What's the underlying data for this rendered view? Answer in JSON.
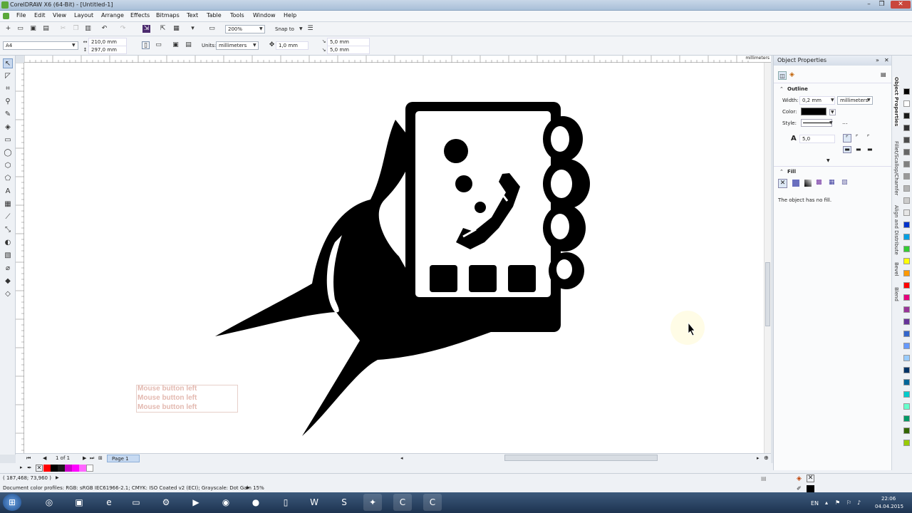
{
  "window": {
    "title": "CorelDRAW X6 (64-Bit) - [Untitled-1]",
    "minimize": "–",
    "restore": "❐",
    "close": "✕"
  },
  "menu": [
    "File",
    "Edit",
    "View",
    "Layout",
    "Arrange",
    "Effects",
    "Bitmaps",
    "Text",
    "Table",
    "Tools",
    "Window",
    "Help"
  ],
  "toolbar": {
    "zoom": "200%",
    "snap_to": "Snap to"
  },
  "property_bar": {
    "page_size": "A4",
    "width": "210,0 mm",
    "height": "297,0 mm",
    "units_label": "Units:",
    "units_value": "millimeters",
    "nudge": "1,0 mm",
    "dup_x": "5,0 mm",
    "dup_y": "5,0 mm"
  },
  "ruler": {
    "unit": "millimeters"
  },
  "object_properties": {
    "title": "Object Properties",
    "outline_title": "Outline",
    "width_label": "Width:",
    "width_value": "0,2 mm",
    "width_units": "millimeters",
    "color_label": "Color:",
    "style_label": "Style:",
    "style_more": "...",
    "miter_value": "5,0",
    "fill_title": "Fill",
    "fill_message": "The object has no fill."
  },
  "docker_tabs": [
    "Object Properties",
    "Fillet/Scallop/Chamfer",
    "Align and Distribute",
    "Bevel",
    "Blend"
  ],
  "page_nav": {
    "position": "1 of 1",
    "page_tab": "Page 1"
  },
  "mouse_labels": [
    "Mouse button left",
    "Mouse button left",
    "Mouse button left"
  ],
  "status": {
    "coords": "( 187,468; 73,960 )",
    "color_profiles": "Document color profiles: RGB: sRGB IEC61966-2.1; CMYK: ISO Coated v2 (ECI); Grayscale: Dot Gain 15%",
    "play_icon": "▶"
  },
  "taskbar": {
    "language": "EN",
    "time": "22:06",
    "date": "04.04.2015"
  },
  "colors": {
    "accent": "#3a6ea5",
    "palette": [
      "#000000",
      "#ffffff",
      "#1a1a1a",
      "#333333",
      "#4d4d4d",
      "#666666",
      "#808080",
      "#999999",
      "#b3b3b3",
      "#cccccc",
      "#e6e6e6",
      "#0033cc",
      "#00a0e3",
      "#33cc33",
      "#ffff00",
      "#ff9900",
      "#ff0000",
      "#e6007e",
      "#993399",
      "#663399",
      "#3366cc",
      "#6699ff",
      "#99ccff",
      "#003366",
      "#006699",
      "#00cccc",
      "#66ffcc",
      "#009966",
      "#336600",
      "#99cc00"
    ]
  }
}
